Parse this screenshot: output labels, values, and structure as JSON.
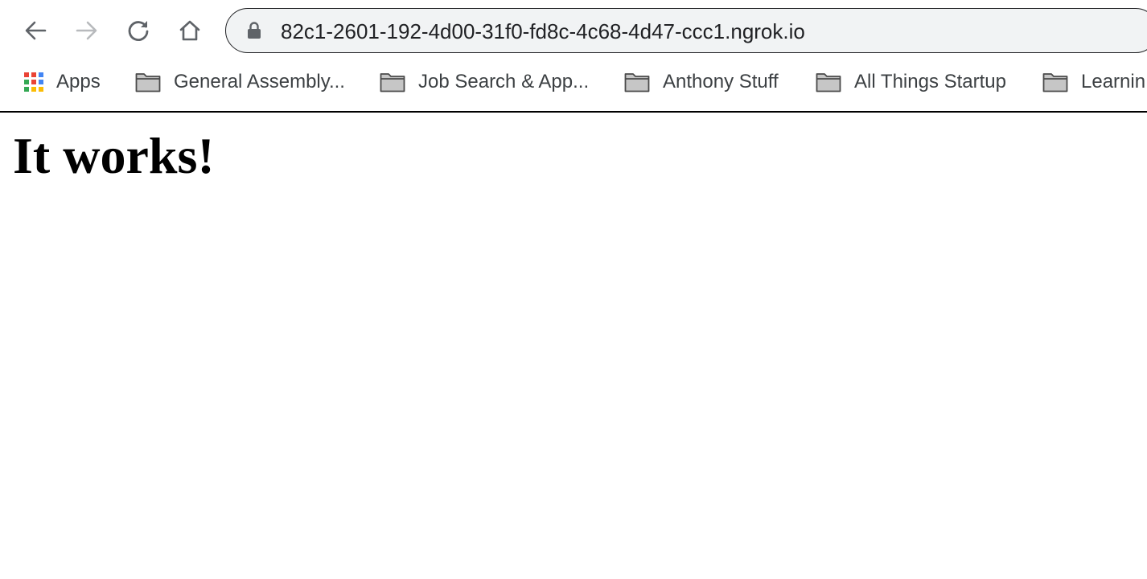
{
  "browser": {
    "url": "82c1-2601-192-4d00-31f0-fd8c-4c68-4d47-ccc1.ngrok.io",
    "bookmarks": [
      {
        "label": "Apps",
        "icon": "apps-grid-icon"
      },
      {
        "label": "General Assembly...",
        "icon": "folder-icon"
      },
      {
        "label": "Job Search & App...",
        "icon": "folder-icon"
      },
      {
        "label": "Anthony Stuff",
        "icon": "folder-icon"
      },
      {
        "label": "All Things Startup",
        "icon": "folder-icon"
      },
      {
        "label": "Learnin",
        "icon": "folder-icon"
      }
    ]
  },
  "page": {
    "heading": "It works!"
  },
  "colors": {
    "omnibox_bg": "#f1f3f4",
    "icon_gray": "#5f6368",
    "icon_disabled": "#b8babd",
    "apps_red": "#ea4335",
    "apps_blue": "#4285f4",
    "apps_yellow": "#fbbc04",
    "apps_green": "#34a853"
  }
}
